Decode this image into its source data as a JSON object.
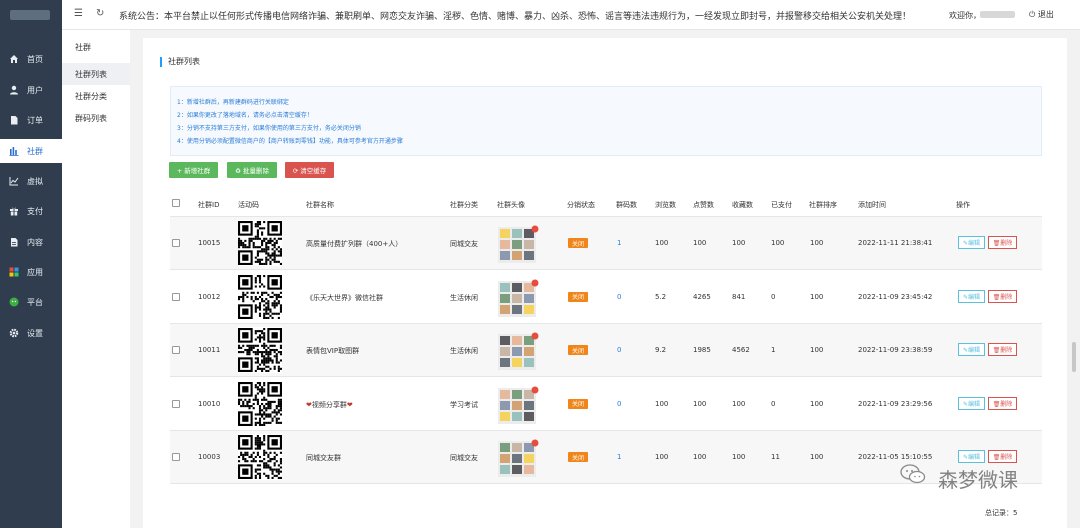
{
  "sidebar": {
    "items": [
      {
        "label": "首页",
        "icon": "home-icon"
      },
      {
        "label": "用户",
        "icon": "user-icon"
      },
      {
        "label": "订单",
        "icon": "order-icon"
      },
      {
        "label": "社群",
        "icon": "group-icon"
      },
      {
        "label": "虚拟",
        "icon": "chart-icon"
      },
      {
        "label": "支付",
        "icon": "gift-icon"
      },
      {
        "label": "内容",
        "icon": "document-icon"
      },
      {
        "label": "应用",
        "icon": "apps-icon"
      },
      {
        "label": "平台",
        "icon": "wechat-icon"
      },
      {
        "label": "设置",
        "icon": "gear-icon"
      }
    ],
    "active_index": 3,
    "active_color": "#2f6fd1",
    "background": "#2f3d4f"
  },
  "submenu": {
    "title": "社群",
    "items": [
      {
        "label": "社群列表"
      },
      {
        "label": "社群分类"
      },
      {
        "label": "群码列表"
      }
    ]
  },
  "header": {
    "notice": "系统公告：本平台禁止以任何形式传播电信网络诈骗、兼职刷单、网恋交友诈骗、淫秽、色情、赌博、暴力、凶杀、恐怖、谣言等违法违规行为，一经发现立即封号，并报警移交给相关公安机关处理！",
    "welcome": "欢迎你，",
    "logout": "退出"
  },
  "panel": {
    "title": "社群列表",
    "tips": [
      "1：新增社群后，再新建群码进行关联绑定",
      "2：如果你更改了落地域名，请务必点击清空缓存！",
      "3：分销不支持第三方支付，如果你使用的第三方支付，务必关闭分销",
      "4：使用分销必须配置微信商户的【商户转账到零钱】功能，具体可参考官方开通步骤"
    ],
    "buttons": {
      "add": "+ 新增社群",
      "batch_delete": "♻ 批量删除",
      "clear_cache": "⟳ 清空缓存"
    }
  },
  "table": {
    "headers": [
      "社群ID",
      "活动码",
      "社群名称",
      "社群分类",
      "社群头像",
      "分销状态",
      "群码数",
      "浏览数",
      "点赞数",
      "收藏数",
      "已支付",
      "社群排序",
      "添加时间",
      "操作"
    ],
    "rows": [
      {
        "id": "10015",
        "name": "高质量付费扩列群（400+人）",
        "category": "同城交友",
        "status": "关闭",
        "codes": "1",
        "views": "100",
        "likes": "100",
        "favorites": "100",
        "paid": "100",
        "sort": "100",
        "time": "2022-11-11 21:38:41",
        "edit": "✎编辑",
        "delete": "🗑删除"
      },
      {
        "id": "10012",
        "name": "《乐天大世界》微信社群",
        "category": "生活休闲",
        "status": "关闭",
        "codes": "0",
        "views": "5.2",
        "likes": "4265",
        "favorites": "841",
        "paid": "0",
        "sort": "100",
        "time": "2022-11-09 23:45:42",
        "edit": "✎编辑",
        "delete": "🗑删除"
      },
      {
        "id": "10011",
        "name": "表情包VIP取图群",
        "category": "生活休闲",
        "status": "关闭",
        "codes": "0",
        "views": "9.2",
        "likes": "1985",
        "favorites": "4562",
        "paid": "1",
        "sort": "100",
        "time": "2022-11-09 23:38:59",
        "edit": "✎编辑",
        "delete": "🗑删除"
      },
      {
        "id": "10010",
        "name": "视频分享群",
        "name_heart": "❤",
        "category": "学习考试",
        "status": "关闭",
        "codes": "0",
        "views": "100",
        "likes": "100",
        "favorites": "100",
        "paid": "0",
        "sort": "100",
        "time": "2022-11-09 23:29:56",
        "edit": "✎编辑",
        "delete": "🗑删除"
      },
      {
        "id": "10003",
        "name": "同城交友群",
        "category": "同城交友",
        "status": "关闭",
        "codes": "1",
        "views": "100",
        "likes": "100",
        "favorites": "100",
        "paid": "11",
        "sort": "100",
        "time": "2022-11-05 15:10:55",
        "edit": "✎编辑",
        "delete": "🗑删除"
      }
    ]
  },
  "footer": {
    "total": "总记录：5",
    "watermark": "森梦微课"
  },
  "colors": {
    "success": "#5cb85c",
    "danger": "#d9534f",
    "warning": "#f0861a",
    "info": "#5bc0de",
    "link": "#2a7dd6"
  }
}
